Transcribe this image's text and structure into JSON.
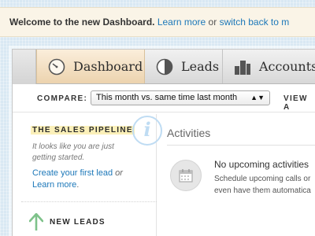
{
  "notice": {
    "headline": "Welcome to the new Dashboard.",
    "learn_more": "Learn more",
    "or": "or",
    "switch_back": "switch back to m"
  },
  "nav": {
    "tabs": [
      {
        "label": "Dashboard",
        "icon": "speedometer-icon",
        "active": true
      },
      {
        "label": "Leads",
        "icon": "pie-chart-icon",
        "active": false
      },
      {
        "label": "Accounts",
        "icon": "buildings-icon",
        "active": false
      }
    ]
  },
  "compare": {
    "label": "COMPARE:",
    "selected": "This month vs. same time last month",
    "view_label": "VIEW A"
  },
  "pipeline": {
    "title": "THE SALES PIPELINE",
    "info_glyph": "i",
    "description": "It looks like you are just getting started.",
    "create_link": "Create your first lead",
    "or": "or",
    "learn_more": "Learn more",
    "period": "."
  },
  "new_leads": {
    "label": "NEW LEADS"
  },
  "activities": {
    "title": "Activities",
    "empty_title": "No upcoming activities",
    "schedule_line1": "Schedule upcoming calls or",
    "schedule_line2": "even have them automatica"
  },
  "colors": {
    "accent": "#1d78b9",
    "active_tab": "#f3dfbf",
    "highlight": "#fbf0b9",
    "arrow_green": "#7ec28a",
    "background": "#d9e8f3"
  }
}
